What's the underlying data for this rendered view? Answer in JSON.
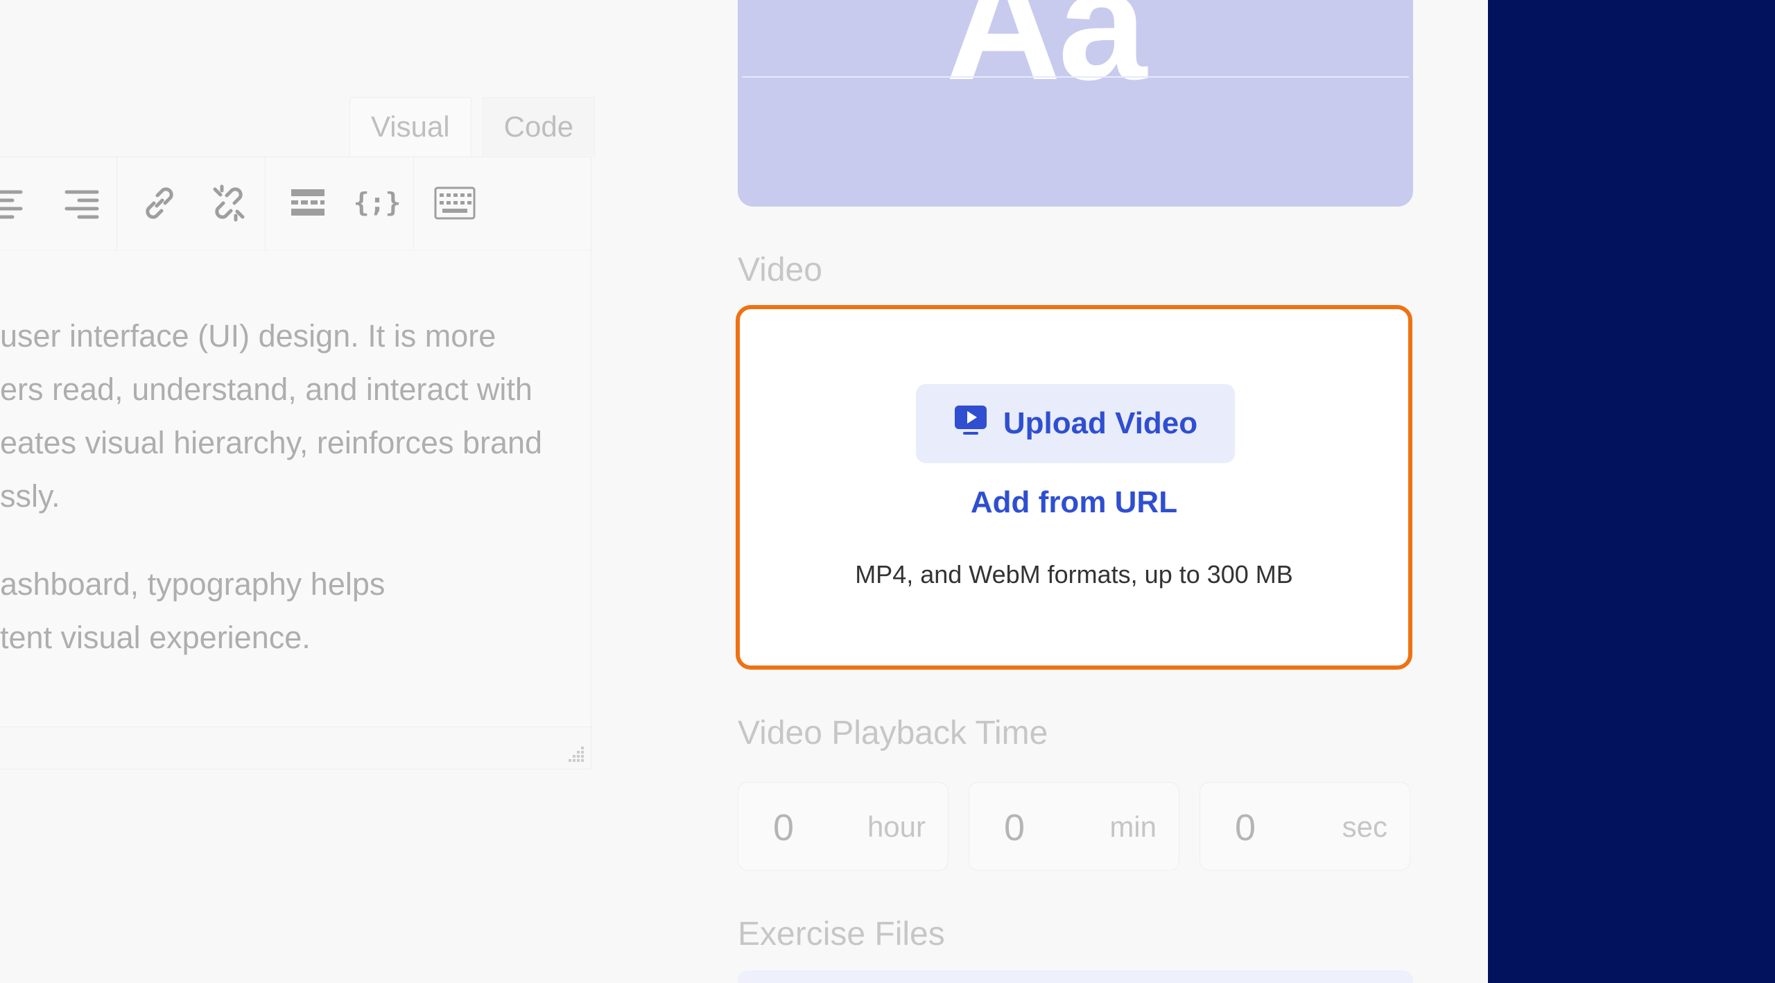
{
  "editor": {
    "tabs": [
      "Visual",
      "Code"
    ],
    "toolbar_icons": [
      "align-center-icon",
      "align-right-icon",
      "link-icon",
      "unlink-icon",
      "read-more-icon",
      "code-block-icon",
      "keyboard-icon"
    ],
    "paragraphs": [
      [
        "user interface (UI) design. It is more",
        "ers read, understand, and interact with",
        "eates visual hierarchy, reinforces brand",
        "ssly."
      ],
      [
        "ashboard, typography helps",
        "tent visual experience."
      ]
    ]
  },
  "thumbnail": {
    "text": "Aa"
  },
  "video_section": {
    "label": "Video",
    "upload_label": "Upload Video",
    "url_label": "Add from URL",
    "formats_text": "MP4, and WebM formats, up to 300 MB"
  },
  "playback": {
    "label": "Video Playback Time",
    "fields": [
      {
        "value": "0",
        "unit": "hour"
      },
      {
        "value": "0",
        "unit": "min"
      },
      {
        "value": "0",
        "unit": "sec"
      }
    ]
  },
  "exercise_files": {
    "label": "Exercise Files"
  },
  "colors": {
    "highlight": "#ee7213",
    "accent": "#2f4fd0",
    "dark_panel": "#03125c"
  }
}
